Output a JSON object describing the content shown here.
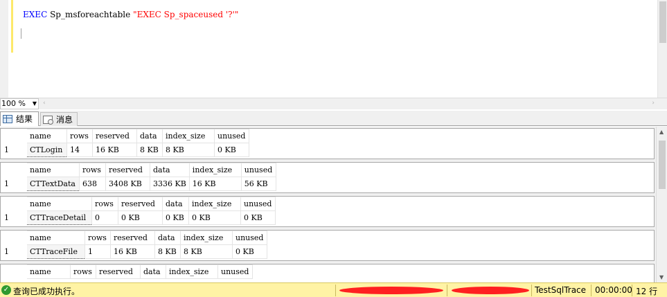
{
  "editor": {
    "code": {
      "keyword": "EXEC",
      "proc": "Sp_msforeachtable",
      "string": "\"EXEC Sp_spaceused '?'\""
    }
  },
  "zoom": {
    "value": "100 %"
  },
  "tabs": [
    {
      "label": "结果",
      "icon": "grid-icon",
      "active": true
    },
    {
      "label": "消息",
      "icon": "message-icon",
      "active": false
    }
  ],
  "columns": [
    "name",
    "rows",
    "reserved",
    "data",
    "index_size",
    "unused"
  ],
  "results": [
    {
      "rownum": "1",
      "values": [
        "CTLogin",
        "14",
        "16 KB",
        "8 KB",
        "8 KB",
        "0 KB"
      ]
    },
    {
      "rownum": "1",
      "values": [
        "CTTextData",
        "638",
        "3408 KB",
        "3336 KB",
        "16 KB",
        "56 KB"
      ]
    },
    {
      "rownum": "1",
      "values": [
        "CTTraceDetail",
        "0",
        "0 KB",
        "0 KB",
        "0 KB",
        "0 KB"
      ]
    },
    {
      "rownum": "1",
      "values": [
        "CTTraceFile",
        "1",
        "16 KB",
        "8 KB",
        "8 KB",
        "0 KB"
      ]
    },
    {
      "rownum": "",
      "values": [
        "",
        "",
        "",
        "",
        "",
        ""
      ]
    }
  ],
  "status": {
    "message": "查询已成功执行。",
    "database": "TestSqlTrace",
    "elapsed": "00:00:00",
    "rows": "12 行",
    "bar_color": "#fff3a5",
    "ok_color": "#2f9a2f"
  },
  "colors": {
    "keyword": "#0000ff",
    "string": "#ff0000",
    "change_bar": "#fde96a"
  }
}
